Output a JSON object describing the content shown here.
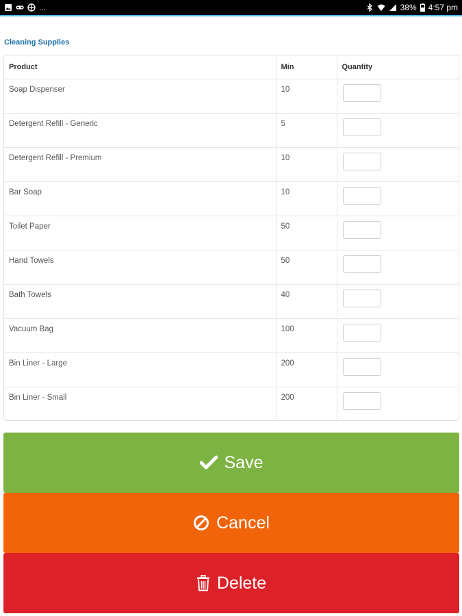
{
  "status_bar": {
    "ellipsis": "...",
    "battery": "38%",
    "time": "4:57 pm"
  },
  "section_title": "Cleaning Supplies",
  "table": {
    "headers": {
      "product": "Product",
      "min": "Min",
      "quantity": "Quantity"
    },
    "rows": [
      {
        "product": "Soap Dispenser",
        "min": "10",
        "quantity": ""
      },
      {
        "product": "Detergent Refill - Generic",
        "min": "5",
        "quantity": ""
      },
      {
        "product": "Detergent Refill - Premium",
        "min": "10",
        "quantity": ""
      },
      {
        "product": "Bar Soap",
        "min": "10",
        "quantity": ""
      },
      {
        "product": "Toilet Paper",
        "min": "50",
        "quantity": ""
      },
      {
        "product": "Hand Towels",
        "min": "50",
        "quantity": ""
      },
      {
        "product": "Bath Towels",
        "min": "40",
        "quantity": ""
      },
      {
        "product": "Vacuum Bag",
        "min": "100",
        "quantity": ""
      },
      {
        "product": "Bin Liner - Large",
        "min": "200",
        "quantity": ""
      },
      {
        "product": "Bin Liner - Small",
        "min": "200",
        "quantity": ""
      }
    ]
  },
  "buttons": {
    "save": {
      "label": "Save",
      "icon": "check-icon",
      "color": "#7cb342"
    },
    "cancel": {
      "label": "Cancel",
      "icon": "ban-icon",
      "color": "#f26409"
    },
    "delete": {
      "label": "Delete",
      "icon": "trash-icon",
      "color": "#dc2128"
    }
  },
  "colors": {
    "accent": "#4fb3e8",
    "section_title": "#1f6fa8"
  }
}
